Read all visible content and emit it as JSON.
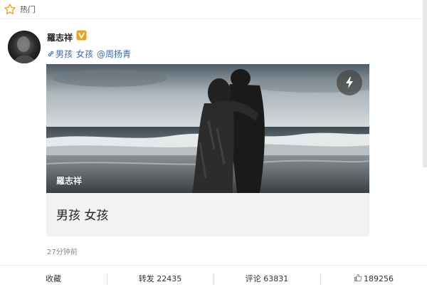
{
  "header": {
    "label": "热门"
  },
  "post": {
    "username": "羅志祥",
    "badge_icon": "verified-v-icon",
    "tags": [
      "男孩",
      "女孩",
      "@周扬青"
    ],
    "card": {
      "watermark": "羅志祥",
      "title": "男孩 女孩"
    },
    "time": "27分钟前"
  },
  "actions": {
    "collect": "收藏",
    "repost": "转发 22435",
    "comment": "评论 63831",
    "like": "189256"
  },
  "colors": {
    "link": "#3e6aa6",
    "badge": "#f0a020",
    "card_bg": "#f2f2f4"
  }
}
